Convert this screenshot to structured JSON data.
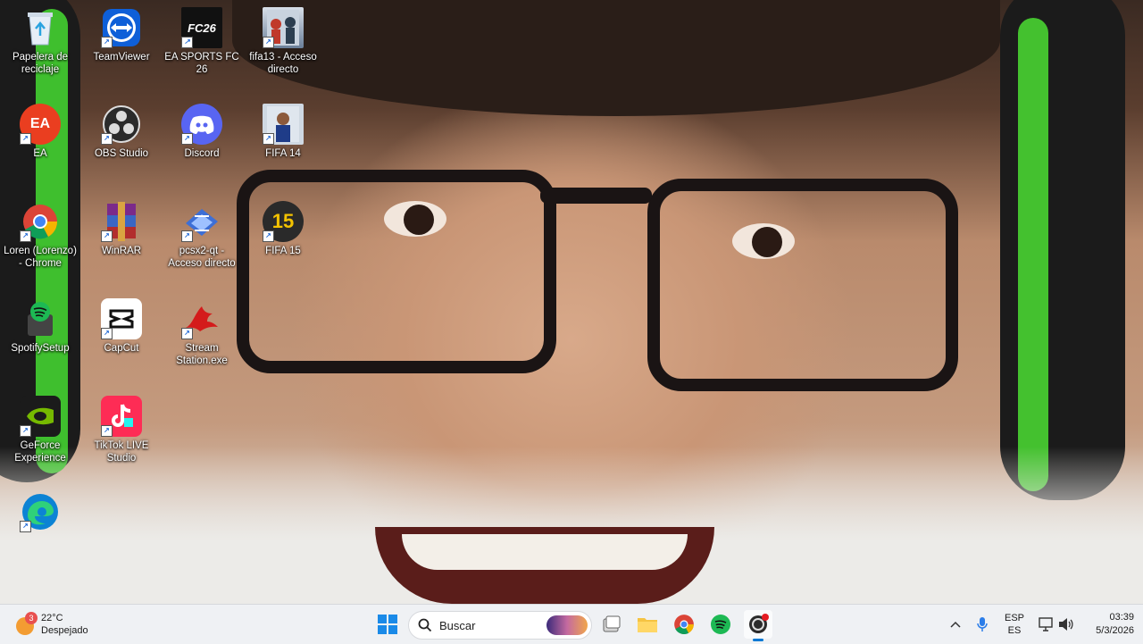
{
  "desktop": {
    "icons": [
      {
        "label": "Papelera de reciclaje",
        "icon": "recycle-bin-icon"
      },
      {
        "label": "TeamViewer",
        "icon": "teamviewer-icon"
      },
      {
        "label": "EA SPORTS FC 26",
        "icon": "fc26-icon",
        "glyph": "FC26"
      },
      {
        "label": "fifa13 - Acceso directo",
        "icon": "fifa13-icon"
      },
      {
        "label": "EA",
        "icon": "ea-icon",
        "glyph": "EA"
      },
      {
        "label": "OBS Studio",
        "icon": "obs-icon"
      },
      {
        "label": "Discord",
        "icon": "discord-icon"
      },
      {
        "label": "FIFA 14",
        "icon": "fifa14-icon"
      },
      {
        "label": "Loren (Lorenzo) - Chrome",
        "icon": "chrome-icon"
      },
      {
        "label": "WinRAR",
        "icon": "winrar-icon"
      },
      {
        "label": "pcsx2-qt - Acceso directo",
        "icon": "pcsx2-icon"
      },
      {
        "label": "FIFA 15",
        "icon": "fifa15-icon",
        "glyph": "15"
      },
      {
        "label": "SpotifySetup",
        "icon": "spotify-icon"
      },
      {
        "label": "CapCut",
        "icon": "capcut-icon"
      },
      {
        "label": "Stream Station.exe",
        "icon": "stream-station-icon"
      },
      {
        "label": "GeForce Experience",
        "icon": "geforce-icon"
      },
      {
        "label": "TikTok LIVE Studio",
        "icon": "tiktok-live-icon"
      },
      {
        "label": "",
        "icon": "edge-icon"
      }
    ]
  },
  "taskbar": {
    "weather": {
      "temp": "22°C",
      "condition": "Despejado",
      "badge": "3"
    },
    "search": {
      "placeholder": "Buscar"
    },
    "tray": {
      "lang_top": "ESP",
      "lang_bottom": "ES",
      "time": "03:39",
      "date": "5/3/2026"
    }
  },
  "colors": {
    "accent": "#0078d4",
    "spotify": "#1db954",
    "headphone_green": "#3fbf2e"
  }
}
